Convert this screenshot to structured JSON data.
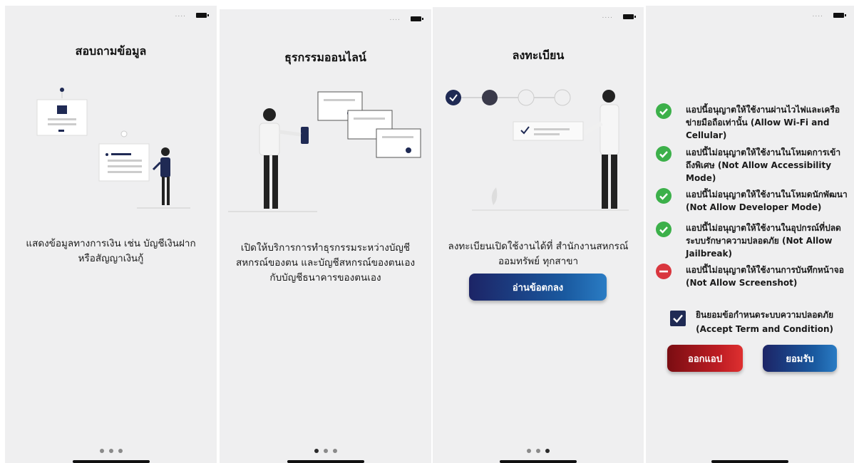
{
  "screens": [
    {
      "title": "สอบถามข้อมูล",
      "description_line1": "แสดงข้อมูลทางการเงิน เช่น บัญชีเงินฝาก",
      "description_line2": "หรือสัญญาเงินกู้"
    },
    {
      "title": "ธุรกรรมออนไลน์",
      "description_line1": "เปิดให้บริการการทำธุรกรรมระหว่างบัญชี",
      "description_line2": "สหกรณ์ของตน และบัญชีสหกรณ์ของตนเอง",
      "description_line3": "กับบัญชีธนาคารของตนเอง"
    },
    {
      "title": "ลงทะเบียน",
      "description_line1": "ลงทะเบียนเปิดใช้งานได้ที่ สำนักงานสหกรณ์",
      "description_line2": "ออมทรัพย์ ทุกสาขา",
      "read_terms_button": "อ่านข้อตกลง"
    },
    {
      "permissions": [
        {
          "status": "allowed",
          "text": "แอปนี้อนุญาตให้ใช้งานผ่านไวไฟและเครือข่ายมือถือเท่านั้น (Allow Wi-Fi and Cellular)"
        },
        {
          "status": "allowed",
          "text": "แอปนี้ไม่อนุญาตให้ใช้งานในโหมดการเข้าถึงพิเศษ (Not Allow Accessibility Mode)"
        },
        {
          "status": "allowed",
          "text": "แอปนี้ไม่อนุญาตให้ใช้งานในโหมดนักพัฒนา (Not Allow Developer Mode)"
        },
        {
          "status": "allowed",
          "text": "แอปนี้ไม่อนุญาตให้ใช้งานในอุปกรณ์ที่ปลดระบบรักษาความปลอดภัย (Not Allow Jailbreak)"
        },
        {
          "status": "blocked",
          "text": "แอปนี้ไม่อนุญาตให้ใช้งานการบันทึกหน้าจอ (Not Allow Screenshot)"
        }
      ],
      "accept_line1": "ยินยอมข้อกำหนดระบบความปลอดภัย",
      "accept_line2": "(Accept Term and Condition)",
      "accept_checked": true,
      "exit_button": "ออกแอป",
      "accept_button": "ยอมรับ"
    }
  ],
  "pager": [
    {
      "count": 3,
      "active": 0
    },
    {
      "count": 3,
      "active": 0
    },
    {
      "count": 3,
      "active": 2
    }
  ],
  "onboarding_steps": {
    "count": 4,
    "completed": 1,
    "current": 2
  },
  "status_bar": {
    "signal": "....",
    "battery": "battery-icon"
  },
  "colors": {
    "navy": "#1f2a54",
    "blue_button": "#1a5aa0",
    "red_button": "#c01e24",
    "check_green": "#3cb04a",
    "block_red": "#d9363e",
    "background": "#efeff0"
  }
}
